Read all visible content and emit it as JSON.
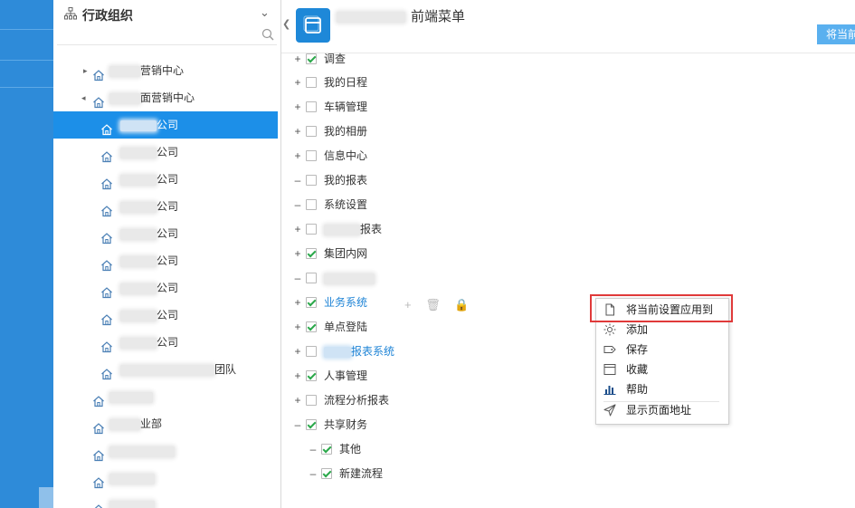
{
  "tree": {
    "title": "行政组织",
    "search_placeholder": "",
    "nodes": [
      {
        "label": "营销中心"
      },
      {
        "label": "面营销中心"
      },
      {
        "label": "公司"
      },
      {
        "label": "公司"
      },
      {
        "label": "公司"
      },
      {
        "label": "公司"
      },
      {
        "label": "公司"
      },
      {
        "label": "公司"
      },
      {
        "label": "公司"
      },
      {
        "label": "公司"
      },
      {
        "label": "公司"
      },
      {
        "label": "团队"
      },
      {
        "label": ""
      },
      {
        "label": "业部"
      },
      {
        "label": ""
      },
      {
        "label": ""
      },
      {
        "label": ""
      }
    ]
  },
  "header": {
    "title": "前端菜单",
    "apply_button": "将当前"
  },
  "menu_items": [
    {
      "expander": "+",
      "checked": true,
      "label": "调查"
    },
    {
      "expander": "+",
      "checked": false,
      "label": "我的日程"
    },
    {
      "expander": "+",
      "checked": false,
      "label": "车辆管理"
    },
    {
      "expander": "+",
      "checked": false,
      "label": "我的相册"
    },
    {
      "expander": "+",
      "checked": false,
      "label": "信息中心"
    },
    {
      "expander": "–",
      "checked": false,
      "label": "我的报表"
    },
    {
      "expander": "–",
      "checked": false,
      "label": "系统设置"
    },
    {
      "expander": "+",
      "checked": false,
      "label": "报表"
    },
    {
      "expander": "+",
      "checked": true,
      "label": "集团内网"
    },
    {
      "expander": "–",
      "checked": false,
      "label": ""
    },
    {
      "expander": "+",
      "checked": true,
      "label": "业务系统"
    },
    {
      "expander": "+",
      "checked": true,
      "label": "单点登陆"
    },
    {
      "expander": "+",
      "checked": false,
      "label": "报表系统"
    },
    {
      "expander": "+",
      "checked": true,
      "label": "人事管理"
    },
    {
      "expander": "+",
      "checked": false,
      "label": "流程分析报表"
    },
    {
      "expander": "–",
      "checked": true,
      "label": "共享财务"
    },
    {
      "expander": "–",
      "checked": true,
      "label": "其他"
    },
    {
      "expander": "–",
      "checked": true,
      "label": "新建流程"
    }
  ],
  "row_tools": {
    "add": "+",
    "delete": "🗑",
    "lock": "🔒"
  },
  "context_menu": [
    {
      "label": "将当前设置应用到",
      "icon": "document-icon"
    },
    {
      "label": "添加",
      "icon": "sun-icon"
    },
    {
      "label": "保存",
      "icon": "tag-icon"
    },
    {
      "label": "收藏",
      "icon": "window-icon"
    },
    {
      "label": "帮助",
      "icon": "bar-chart-icon"
    },
    {
      "label": "显示页面地址",
      "icon": "send-icon"
    }
  ],
  "colors": {
    "accent": "#1c8fe8",
    "highlight_box": "#e03a3a",
    "check": "#2aa84a"
  }
}
